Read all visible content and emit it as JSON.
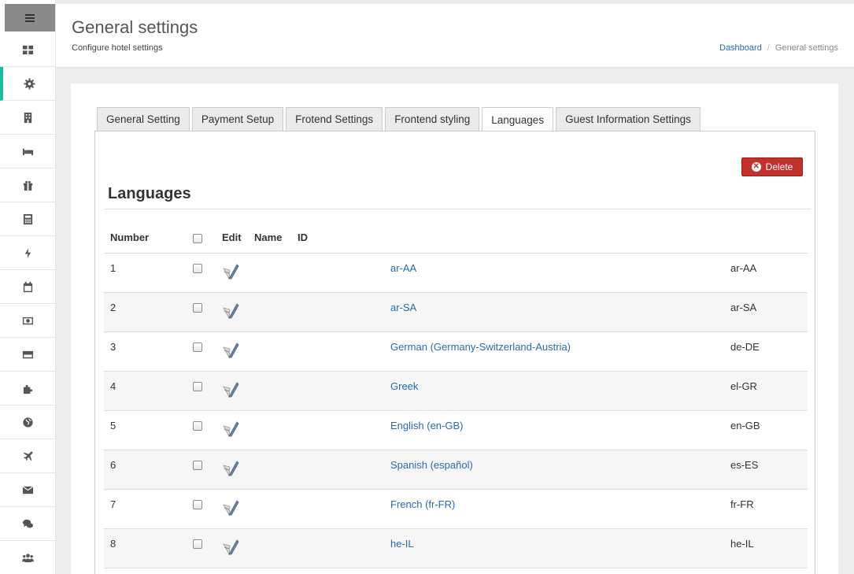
{
  "sidebar": {
    "toggle_icon": "hamburger-icon",
    "items": [
      {
        "icon": "dashboard-icon"
      },
      {
        "icon": "gear-icon",
        "active": true
      },
      {
        "icon": "building-icon"
      },
      {
        "icon": "bed-icon"
      },
      {
        "icon": "gift-icon"
      },
      {
        "icon": "calculator-icon"
      },
      {
        "icon": "bolt-icon"
      },
      {
        "icon": "calendar-icon"
      },
      {
        "icon": "money-icon"
      },
      {
        "icon": "credit-card-icon"
      },
      {
        "icon": "puzzle-icon"
      },
      {
        "icon": "globe-icon"
      },
      {
        "icon": "plane-icon"
      },
      {
        "icon": "envelope-icon"
      },
      {
        "icon": "comments-icon"
      },
      {
        "icon": "users-icon"
      }
    ],
    "accent_color": "#1abc9c"
  },
  "header": {
    "title": "General settings",
    "subtitle": "Configure hotel settings",
    "breadcrumb": {
      "home": "Dashboard",
      "separator": "/",
      "current": "General settings"
    }
  },
  "tabs": [
    {
      "label": "General Setting"
    },
    {
      "label": "Payment Setup"
    },
    {
      "label": "Frotend Settings"
    },
    {
      "label": "Frontend styling"
    },
    {
      "label": "Languages",
      "active": true
    },
    {
      "label": "Guest Information Settings"
    }
  ],
  "languages_section": {
    "title": "Languages",
    "delete_label": "Delete",
    "delete_color": "#c0322b",
    "columns": {
      "number": "Number",
      "edit": "Edit",
      "name": "Name",
      "id": "ID"
    },
    "rows": [
      {
        "number": "1",
        "name": "ar-AA",
        "id": "ar-AA"
      },
      {
        "number": "2",
        "name": "ar-SA",
        "id": "ar-SA"
      },
      {
        "number": "3",
        "name": "German (Germany-Switzerland-Austria)",
        "id": "de-DE"
      },
      {
        "number": "4",
        "name": "Greek",
        "id": "el-GR"
      },
      {
        "number": "5",
        "name": "English (en-GB)",
        "id": "en-GB"
      },
      {
        "number": "6",
        "name": "Spanish (español)",
        "id": "es-ES"
      },
      {
        "number": "7",
        "name": "French (fr-FR)",
        "id": "fr-FR"
      },
      {
        "number": "8",
        "name": "he-IL",
        "id": "he-IL"
      }
    ]
  }
}
